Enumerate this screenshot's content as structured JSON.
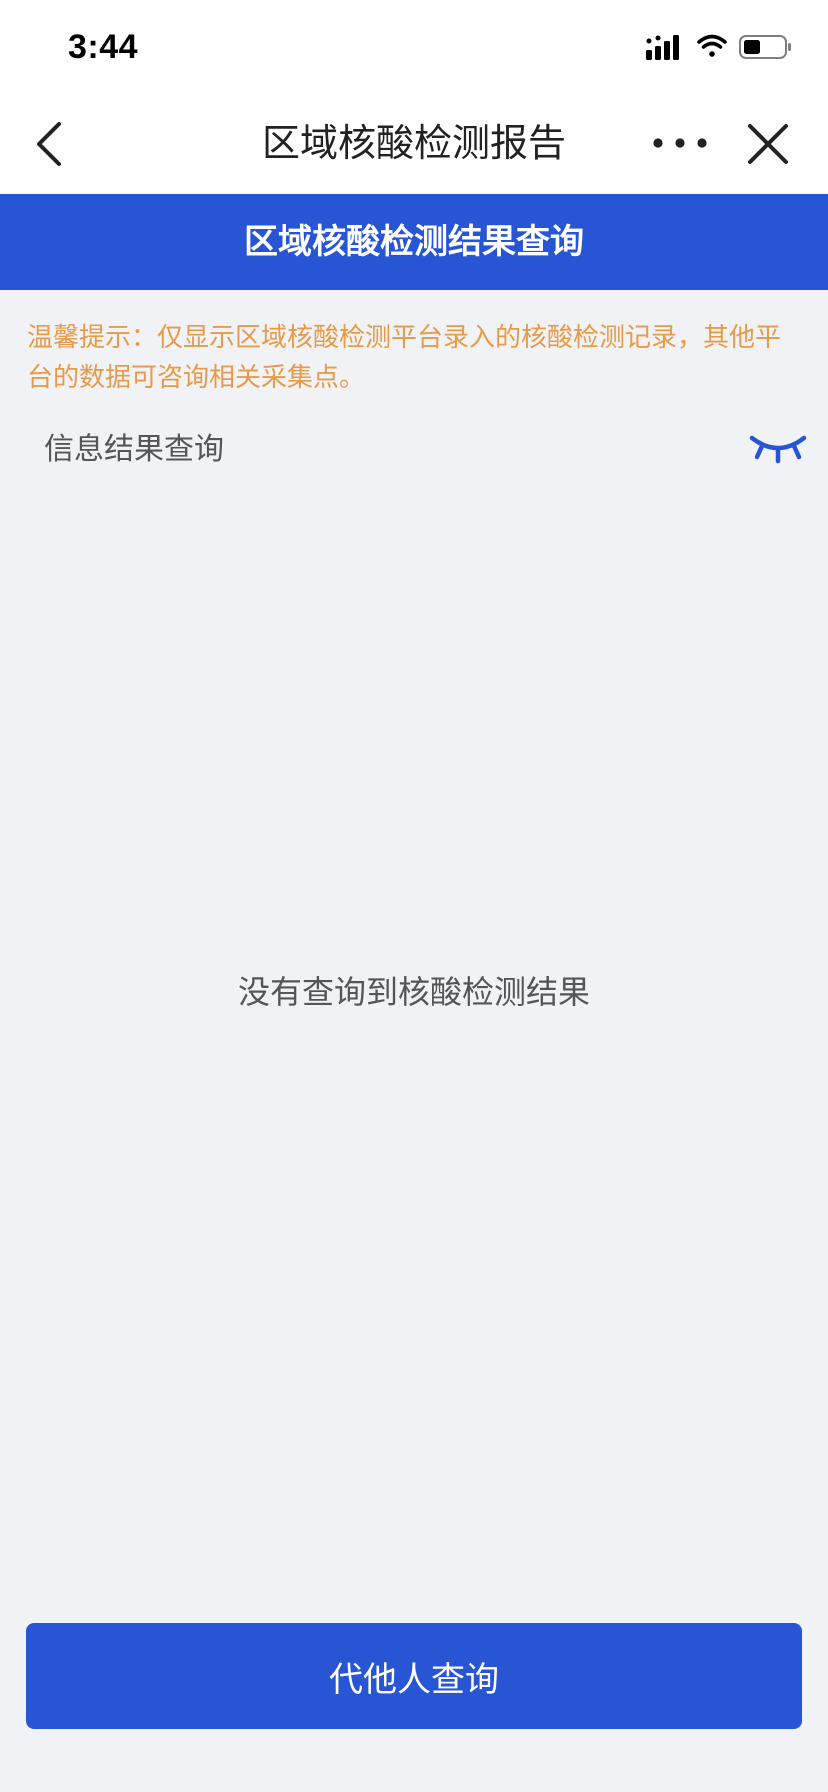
{
  "status_bar": {
    "time": "3:44",
    "icons": [
      "signal-icon",
      "wifi-icon",
      "battery-icon"
    ]
  },
  "nav": {
    "title": "区域核酸检测报告",
    "icons": [
      "back-icon",
      "more-icon",
      "close-icon"
    ]
  },
  "header": {
    "title": "区域核酸检测结果查询"
  },
  "tip": {
    "text": "温馨提示：仅显示区域核酸检测平台录入的核酸检测记录，其他平台的数据可咨询相关采集点。"
  },
  "section": {
    "label": "信息结果查询",
    "toggle_icon": "eye-closed-icon"
  },
  "empty_state": {
    "message": "没有查询到核酸检测结果"
  },
  "footer": {
    "button_label": "代他人查询"
  },
  "colors": {
    "primary": "#2755d4",
    "tip": "#e69b48",
    "background": "#f0f2f5"
  }
}
